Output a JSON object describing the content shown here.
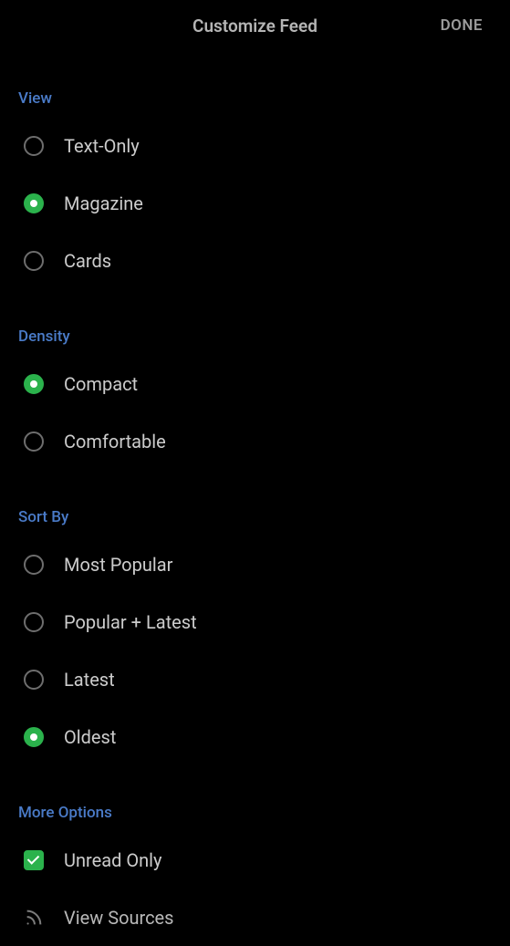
{
  "header": {
    "title": "Customize Feed",
    "done": "DONE"
  },
  "sections": {
    "view": {
      "title": "View",
      "options": [
        {
          "label": "Text-Only",
          "selected": false
        },
        {
          "label": "Magazine",
          "selected": true
        },
        {
          "label": "Cards",
          "selected": false
        }
      ]
    },
    "density": {
      "title": "Density",
      "options": [
        {
          "label": "Compact",
          "selected": true
        },
        {
          "label": "Comfortable",
          "selected": false
        }
      ]
    },
    "sortBy": {
      "title": "Sort By",
      "options": [
        {
          "label": "Most Popular",
          "selected": false
        },
        {
          "label": "Popular + Latest",
          "selected": false
        },
        {
          "label": "Latest",
          "selected": false
        },
        {
          "label": "Oldest",
          "selected": true
        }
      ]
    },
    "moreOptions": {
      "title": "More Options",
      "unreadOnly": {
        "label": "Unread Only",
        "checked": true
      },
      "viewSources": {
        "label": "View Sources"
      }
    }
  }
}
